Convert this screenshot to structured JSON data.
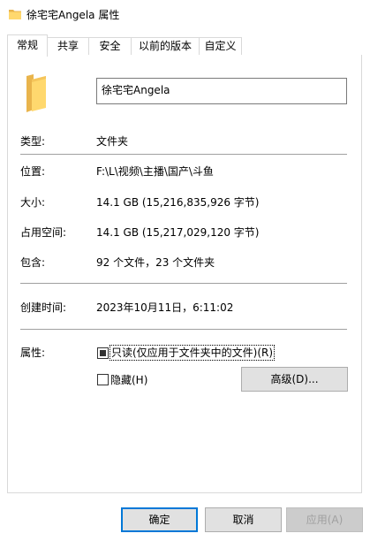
{
  "window": {
    "title": "徐宅宅Angela 属性",
    "icon": "folder-icon"
  },
  "tabs": [
    {
      "label": "常规",
      "active": true
    },
    {
      "label": "共享",
      "active": false
    },
    {
      "label": "安全",
      "active": false
    },
    {
      "label": "以前的版本",
      "active": false
    },
    {
      "label": "自定义",
      "active": false
    }
  ],
  "general": {
    "folder_name": "徐宅宅Angela",
    "type_label": "类型:",
    "type_value": "文件夹",
    "location_label": "位置:",
    "location_value": "F:\\L\\视频\\主播\\国产\\斗鱼",
    "size_label": "大小:",
    "size_value": "14.1 GB (15,216,835,926 字节)",
    "size_on_disk_label": "占用空间:",
    "size_on_disk_value": "14.1 GB (15,217,029,120 字节)",
    "contains_label": "包含:",
    "contains_value": "92 个文件，23 个文件夹",
    "created_label": "创建时间:",
    "created_value": "2023年10月11日，6:11:02",
    "attributes_label": "属性:",
    "readonly_label": "只读(仅应用于文件夹中的文件)(R)",
    "readonly_state": "indeterminate",
    "hidden_label": "隐藏(H)",
    "hidden_checked": false,
    "advanced_label": "高级(D)..."
  },
  "buttons": {
    "ok": "确定",
    "cancel": "取消",
    "apply": "应用(A)"
  },
  "colors": {
    "folder_body": "#f5c55b",
    "folder_front": "#ffd86e",
    "accent": "#0078d7"
  }
}
